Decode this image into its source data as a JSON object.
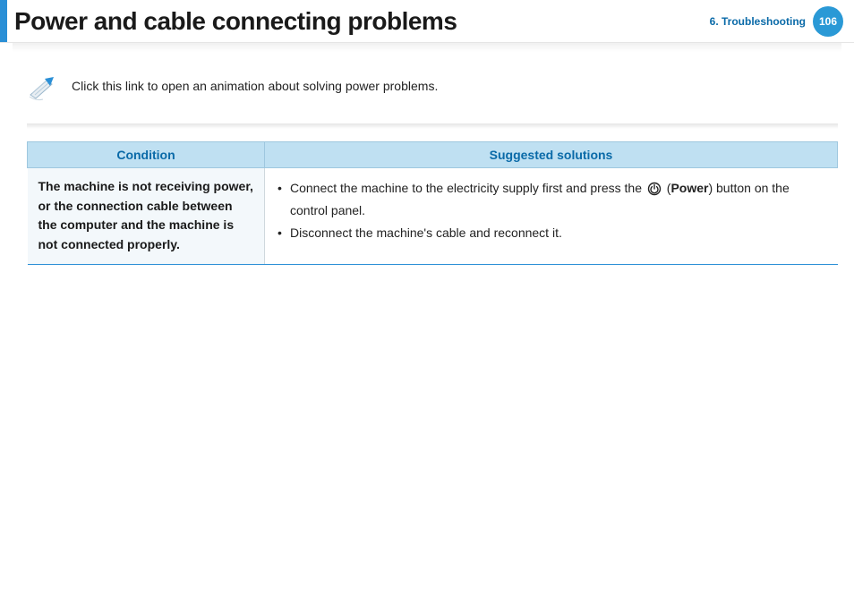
{
  "header": {
    "title": "Power and cable connecting problems",
    "section": "6.  Troubleshooting",
    "page_number": "106"
  },
  "note": {
    "link_text": "Click this link to open an animation about solving power problems."
  },
  "table": {
    "headers": {
      "condition": "Condition",
      "solutions": "Suggested solutions"
    },
    "rows": [
      {
        "condition": "The machine is not receiving power, or the connection cable between the computer and the machine is not connected properly.",
        "solutions": {
          "s1_pre": "Connect the machine to the electricity supply first and press the ",
          "s1_paren_open": "(",
          "s1_power": "Power",
          "s1_post": ") button on the control panel.",
          "s2": "Disconnect the machine's cable and reconnect it."
        }
      }
    ]
  }
}
